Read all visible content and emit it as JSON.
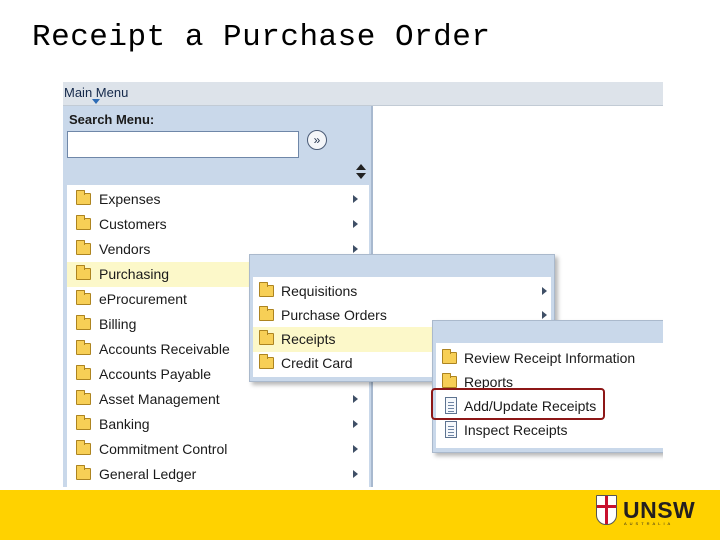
{
  "slide": {
    "title": "Receipt a Purchase Order"
  },
  "menubar": {
    "label": "Main Menu"
  },
  "search": {
    "label": "Search Menu:",
    "value": "",
    "go_glyph": "»"
  },
  "main_menu": {
    "items": [
      {
        "label": "Expenses",
        "submenu": true
      },
      {
        "label": "Customers",
        "submenu": true
      },
      {
        "label": "Vendors",
        "submenu": true
      },
      {
        "label": "Purchasing",
        "submenu": true,
        "highlighted": true
      },
      {
        "label": "eProcurement",
        "submenu": true
      },
      {
        "label": "Billing",
        "submenu": true
      },
      {
        "label": "Accounts Receivable",
        "submenu": true
      },
      {
        "label": "Accounts Payable",
        "submenu": true
      },
      {
        "label": "Asset Management",
        "submenu": true
      },
      {
        "label": "Banking",
        "submenu": true
      },
      {
        "label": "Commitment Control",
        "submenu": true
      },
      {
        "label": "General Ledger",
        "submenu": true
      }
    ]
  },
  "purchasing_menu": {
    "items": [
      {
        "label": "Requisitions",
        "submenu": true
      },
      {
        "label": "Purchase Orders",
        "submenu": true
      },
      {
        "label": "Receipts",
        "submenu": true,
        "highlighted": true
      },
      {
        "label": "Credit Card",
        "submenu": true
      }
    ]
  },
  "receipts_menu": {
    "items": [
      {
        "label": "Review Receipt Information",
        "icon": "folder-icon"
      },
      {
        "label": "Reports",
        "icon": "folder-icon"
      },
      {
        "label": "Add/Update Receipts",
        "icon": "document-icon",
        "callout": true
      },
      {
        "label": "Inspect Receipts",
        "icon": "document-icon"
      }
    ]
  },
  "colors": {
    "highlight": "#fcf8c9",
    "panel": "#c9d8ea",
    "callout": "#8d1717",
    "footer": "#ffd200"
  },
  "brand": {
    "logo_text": "UNSW",
    "logo_subtext": "AUSTRALIA"
  }
}
